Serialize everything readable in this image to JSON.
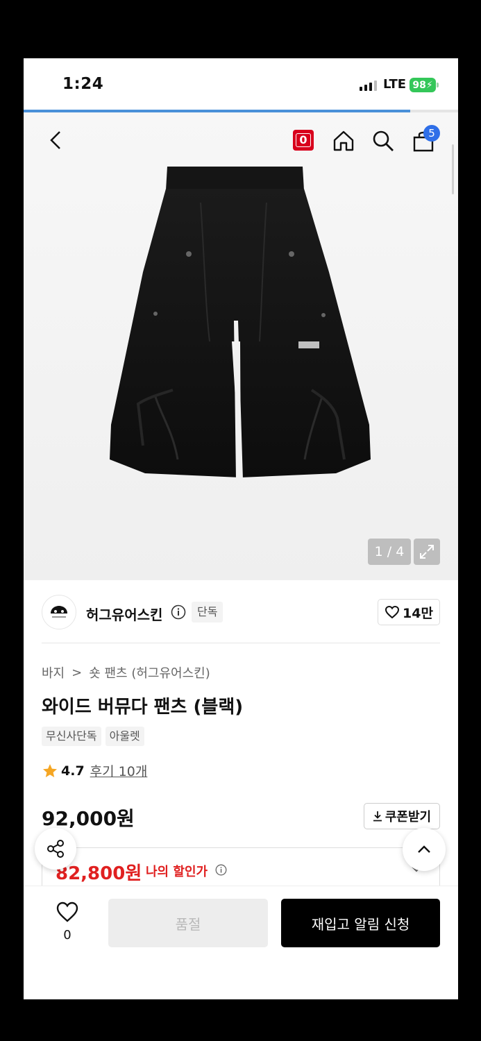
{
  "status_bar": {
    "time": "1:24",
    "network": "LTE",
    "battery": "98"
  },
  "header": {
    "notification_badge": "0",
    "cart_count": "5"
  },
  "gallery": {
    "counter": "1 / 4",
    "page_progress": 0.89
  },
  "brand": {
    "name": "허그유어스킨",
    "exclusive_tag": "단독",
    "likes": "14만"
  },
  "breadcrumb": {
    "category": "바지",
    "separator": ">",
    "subcategory": "숏 팬츠 (허그유어스킨)"
  },
  "product": {
    "title": "와이드 버뮤다 팬츠 (블랙)",
    "tags": [
      "무신사단독",
      "아울렛"
    ],
    "rating": "4.7",
    "reviews": "후기 10개",
    "price": "92,000원",
    "coupon_label": "쿠폰받기",
    "discount_price": "82,800원",
    "discount_label": "나의 할인가"
  },
  "bottom_bar": {
    "wish_count": "0",
    "soldout_label": "품절",
    "restock_label": "재입고 알림 신청"
  },
  "icons": [
    "back-icon",
    "home-icon",
    "search-icon",
    "cart-icon",
    "expand-icon",
    "info-icon",
    "heart-icon",
    "star-icon",
    "download-icon",
    "share-icon",
    "chevron-up-icon",
    "chevron-down-icon"
  ],
  "colors": {
    "accent_red": "#e02020",
    "badge_red": "#d8001c",
    "cart_badge_blue": "#2f6fe8",
    "battery_green": "#34c759",
    "progress_blue": "#4a90d9"
  }
}
